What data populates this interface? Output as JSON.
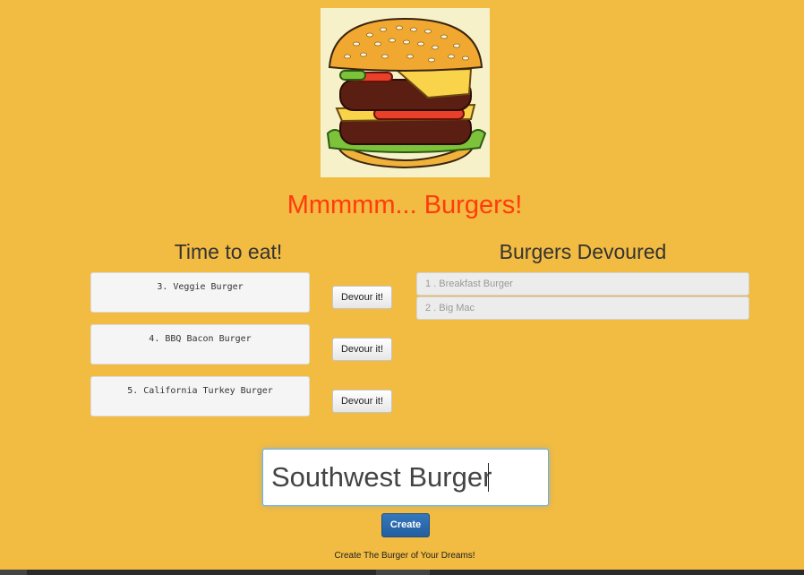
{
  "header": {
    "logo_icon": "burger-icon",
    "title": "Mmmmm... Burgers!"
  },
  "to_eat": {
    "heading": "Time to eat!",
    "burgers": [
      {
        "label": "3. Veggie Burger",
        "button": "Devour it!"
      },
      {
        "label": "4. BBQ Bacon Burger",
        "button": "Devour it!"
      },
      {
        "label": "5. California Turkey Burger",
        "button": "Devour it!"
      }
    ]
  },
  "devoured": {
    "heading": "Burgers Devoured",
    "items": [
      "1 . Breakfast Burger",
      "2 . Big Mac"
    ]
  },
  "form": {
    "input_value": "Southwest Burger",
    "create_label": "Create",
    "tagline": "Create The Burger of Your Dreams!"
  },
  "colors": {
    "background": "#f2bb41",
    "title": "#ff3b0f",
    "create_button": "#2a6aad"
  }
}
